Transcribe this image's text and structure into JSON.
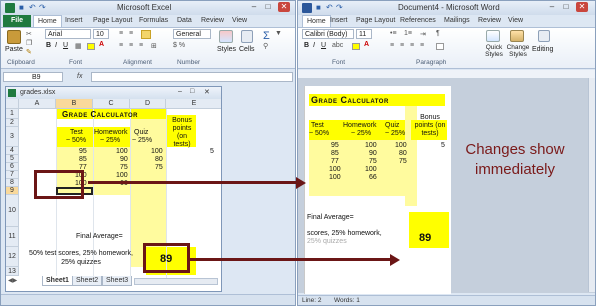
{
  "excel": {
    "title": "Microsoft Excel",
    "tabs": [
      "File",
      "Home",
      "Insert",
      "Page Layout",
      "Formulas",
      "Data",
      "Review",
      "View"
    ],
    "font_name": "Arial",
    "font_size": "10",
    "number_format": "General",
    "buttons": {
      "paste": "Paste",
      "styles": "Styles",
      "cells": "Cells"
    },
    "groups": [
      "Clipboard",
      "Font",
      "Alignment",
      "Number"
    ],
    "name_box": "B9",
    "formula_fx": "fx",
    "workbook_title": "grades.xlsx",
    "columns": [
      "A",
      "B",
      "C",
      "D",
      "E"
    ],
    "rows": [
      "1",
      "2",
      "3",
      "4",
      "5",
      "6",
      "7",
      "8",
      "9",
      "10",
      "11",
      "12",
      "13"
    ],
    "sheet": {
      "title": "Grade Calculator",
      "headers": {
        "test": "Test",
        "test_pct": "~ 50%",
        "homework": "Homework",
        "homework_pct": "~ 25%",
        "quiz": "Quiz",
        "quiz_pct": "~ 25%",
        "bonus": "Bonus points (on tests)"
      },
      "rows": [
        {
          "test": "95",
          "homework": "100",
          "quiz": "100",
          "bonus": "5"
        },
        {
          "test": "85",
          "homework": "90",
          "quiz": "80",
          "bonus": ""
        },
        {
          "test": "77",
          "homework": "75",
          "quiz": "75",
          "bonus": ""
        },
        {
          "test": "100",
          "homework": "100",
          "quiz": "",
          "bonus": ""
        },
        {
          "test": "100",
          "homework": "66",
          "quiz": "",
          "bonus": ""
        }
      ],
      "final_label": "Final Average=",
      "weights_note": "50% test scores, 25% homework, 25% quizzes",
      "final_value": "89"
    },
    "sheet_tabs": [
      "Sheet1",
      "Sheet2",
      "Sheet3"
    ]
  },
  "word": {
    "title": "Document4 - Microsoft Word",
    "tabs": [
      "Home",
      "Insert",
      "Page Layout",
      "References",
      "Mailings",
      "Review",
      "View"
    ],
    "font_name": "Calibri (Body)",
    "font_size": "11",
    "groups": [
      "Font",
      "Paragraph"
    ],
    "buttons": {
      "quick_styles": "Quick Styles",
      "change_styles": "Change Styles",
      "editing": "Editing"
    },
    "doc": {
      "title": "Grade Calculator",
      "final_label": "Final Average=",
      "note_fragment": "scores, 25% homework,",
      "note_fragment2": "25% quizzes",
      "final_value": "89"
    },
    "status": {
      "page": "Line: 2",
      "words": "Words: 1"
    }
  },
  "annotation": {
    "text": "Changes show immediately"
  },
  "colors": {
    "accent_excel": "#1f7a3f",
    "accent_word": "#2b579a",
    "annotation": "#6b1616",
    "highlight": "#ffff00"
  }
}
